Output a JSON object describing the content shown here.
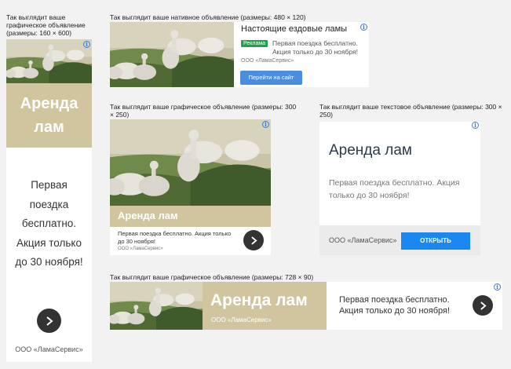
{
  "captions": {
    "c160": "Так выглядит ваше графическое объявление (размеры: 160 × 600)",
    "native": "Так выглядит ваше нативное объявление (размеры: 480 × 120)",
    "g300": "Так выглядит ваше графическое объявление (размеры: 300 × 250)",
    "t300": "Так выглядит ваше текстовое объявление (размеры: 300 × 250)",
    "g728": "Так выглядит ваше графическое объявление (размеры: 728 × 90)"
  },
  "ad": {
    "headline": "Аренда лам",
    "description": "Первая поездка бесплатно. Акция только до 30 ноября!",
    "domain": "ООО «ЛамаСервис»",
    "native_title": "Настоящие ездовые ламы",
    "badge": "Реклама",
    "native_button": "Перейти на сайт",
    "text_button": "ОТКРЫТЬ",
    "info_glyph": "i"
  },
  "colors": {
    "beige": "#d0c59f",
    "button_blue": "#1a88f0",
    "badge_green": "#1fa24a",
    "round_button": "#333333"
  },
  "icons": {
    "info": "info-icon",
    "arrow": "chevron-right-icon"
  }
}
